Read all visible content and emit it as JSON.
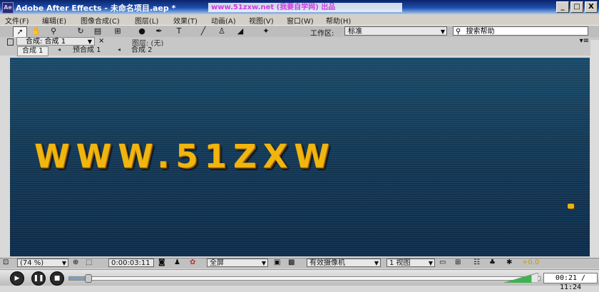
{
  "window": {
    "app_badge": "Ae",
    "title": "Adobe After Effects - 未命名项目.aep *",
    "watermark": "www.51zxw.net (我要自学网) 出品",
    "controls": [
      "_",
      "□",
      "X"
    ]
  },
  "menu": [
    "文件(F)",
    "编辑(E)",
    "图像合成(C)",
    "图层(L)",
    "效果(T)",
    "动画(A)",
    "视图(V)",
    "窗口(W)",
    "帮助(H)"
  ],
  "toolbar": {
    "tools": [
      "selection-tool",
      "hand-tool",
      "zoom-tool",
      "rotate-tool",
      "camera-tool",
      "pan-behind-tool",
      "mask-tool",
      "pen-tool",
      "type-tool",
      "brush-tool",
      "clone-tool",
      "eraser-tool",
      "puppet-tool"
    ],
    "workspace_label": "工作区:",
    "workspace_value": "标准",
    "search_placeholder": "搜索帮助"
  },
  "panel": {
    "comp_tab": "合成: 合成 1",
    "layer_label": "图层: (无)"
  },
  "breadcrumbs": [
    "合成 1",
    "预合成 1",
    "合成 2"
  ],
  "viewer": {
    "text": "WWW.51ZXW"
  },
  "viewer_bottom": {
    "zoom": "(74 %)",
    "timecode": "0:00:03:11",
    "resolution": "全屏",
    "camera": "有效摄像机",
    "views": "1 视图",
    "exposure": "+0.0"
  },
  "player": {
    "progress": 0.04,
    "volume": 0.8,
    "time": "00:21 / 11:24"
  }
}
